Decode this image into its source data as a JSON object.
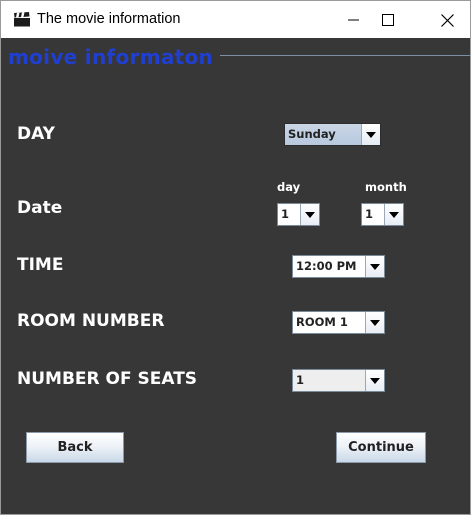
{
  "window": {
    "title": "The movie information",
    "icon": "clapperboard-icon",
    "controls": [
      "minimize-icon",
      "maximize-icon",
      "close-icon"
    ]
  },
  "form": {
    "heading": "moive informaton",
    "day": {
      "label": "DAY",
      "selected": "Sunday"
    },
    "date": {
      "label": "Date",
      "day_label": "day",
      "day_selected": "1",
      "month_label": "month",
      "month_selected": "1"
    },
    "time": {
      "label": "TIME",
      "selected": "12:00 PM"
    },
    "room": {
      "label": "ROOM NUMBER",
      "selected": "ROOM 1"
    },
    "seats": {
      "label": "NUMBER OF SEATS",
      "selected": "1"
    },
    "buttons": {
      "back": "Back",
      "continue": "Continue"
    }
  },
  "colors": {
    "background": "#373737",
    "heading": "#1f3fd3",
    "label": "#ffffff"
  }
}
